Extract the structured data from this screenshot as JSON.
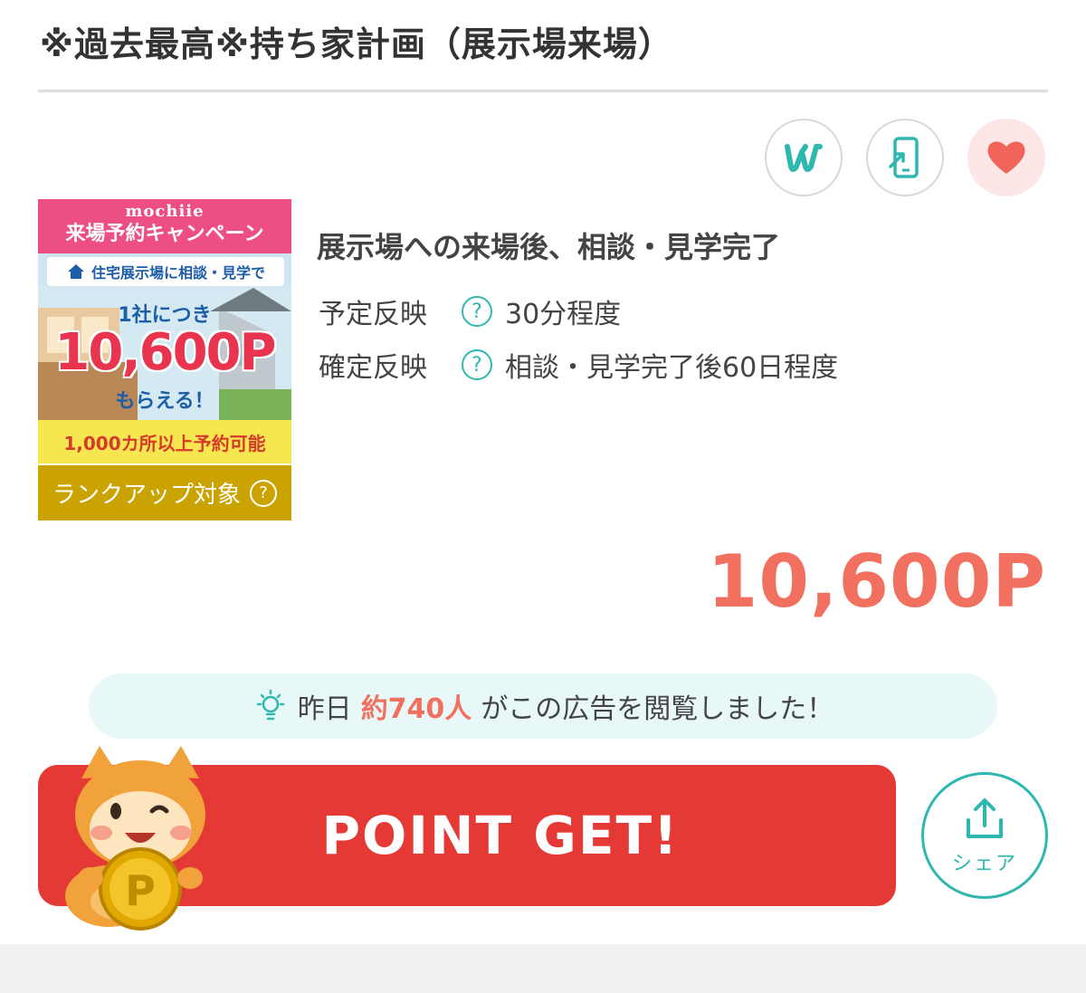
{
  "page": {
    "title": "※過去最高※持ち家計画（展示場来場）"
  },
  "header_actions": [
    {
      "icon": "w-logo-icon",
      "name": "w-button"
    },
    {
      "icon": "mobile-icon",
      "name": "mobile-button"
    },
    {
      "icon": "heart-icon",
      "name": "favorite-button"
    }
  ],
  "banner": {
    "brand": "mochiie",
    "campaign": "来場予約キャンペーン",
    "subtitle": "住宅展示場に相談・見学で",
    "per_company": "1社につき",
    "points": "10,600P",
    "get": "もらえる！",
    "bottom": "1,000カ所以上予約可能"
  },
  "rankup": {
    "label": "ランクアップ対象"
  },
  "offer": {
    "condition": "展示場への来場後、相談・見学完了",
    "rows": [
      {
        "label": "予定反映",
        "value": "30分程度"
      },
      {
        "label": "確定反映",
        "value": "相談・見学完了後60日程度"
      }
    ],
    "points": "10,600P"
  },
  "viewers": {
    "prefix": "昨日",
    "count": "約740人",
    "suffix": "がこの広告を閲覧しました！"
  },
  "cta": {
    "label": "POINT GET!",
    "coin_letter": "P"
  },
  "share": {
    "label": "シェア"
  },
  "colors": {
    "accent_red": "#e53935",
    "points_coral": "#f2705f",
    "teal": "#2fb8b0",
    "rank_gold": "#cba300"
  }
}
